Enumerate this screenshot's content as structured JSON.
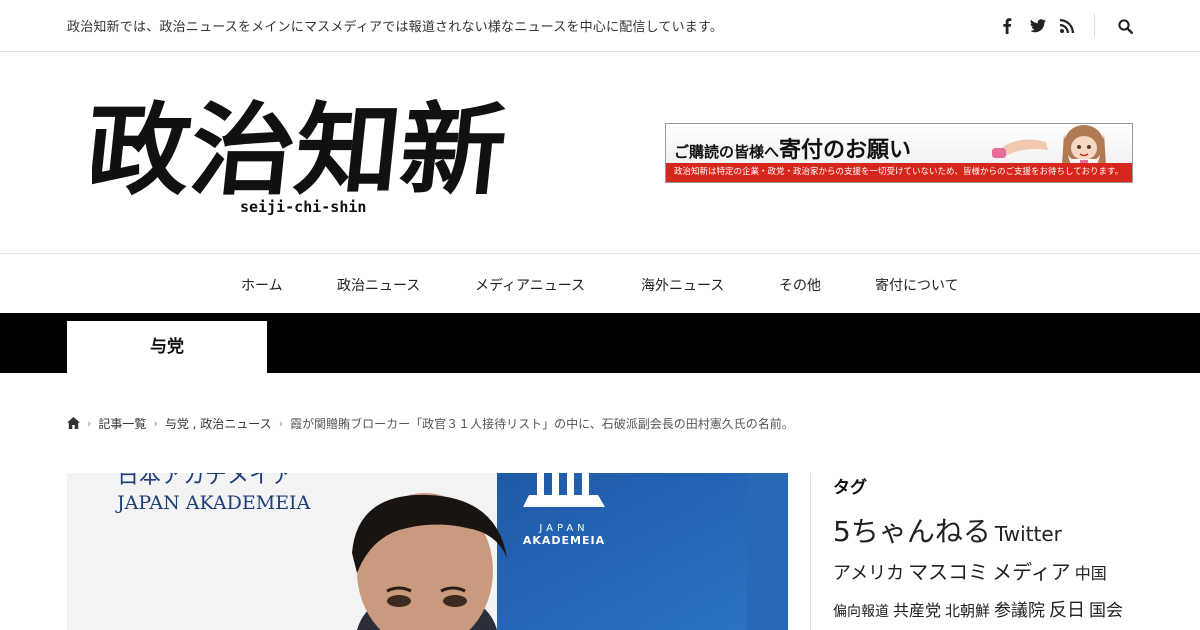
{
  "topbar": {
    "tagline": "政治知新では、政治ニュースをメインにマスメディアでは報道されない様なニュースを中心に配信しています。",
    "icons": [
      "facebook-icon",
      "twitter-icon",
      "rss-icon",
      "search-icon"
    ]
  },
  "header": {
    "logo_text": "政治知新",
    "logo_sub": "seiji-chi-shin",
    "banner": {
      "title_small1": "ご購読の皆様へ",
      "title_big": "寄付のお願い",
      "bottom_text": "政治知新は特定の企業・政党・政治家からの支援を一切受けていないため、皆様からのご支援をお待ちしております。"
    }
  },
  "nav": {
    "items": [
      "ホーム",
      "政治ニュース",
      "メディアニュース",
      "海外ニュース",
      "その他",
      "寄付について"
    ]
  },
  "category": {
    "label": "与党"
  },
  "breadcrumb": {
    "home_icon": "home-icon",
    "items": [
      "記事一覧",
      "与党 , 政治ニュース",
      "霞が関贈賄ブローカー「政官３１人接待リスト」の中に、石破派副会長の田村憲久氏の名前。"
    ]
  },
  "photo": {
    "text_top": "日本アカデメイア",
    "text_en": "JAPAN AKADEMEIA",
    "logo_line1": "JAPAN",
    "logo_line2": "AKADEMEIA"
  },
  "sidebar": {
    "title": "タグ",
    "tags": [
      {
        "label": "5ちゃんねる",
        "size": 28
      },
      {
        "label": "Twitter",
        "size": 20
      },
      {
        "label": "アメリカ",
        "size": 18
      },
      {
        "label": "マスコミ",
        "size": 20
      },
      {
        "label": "メディア",
        "size": 20
      },
      {
        "label": "中国",
        "size": 16
      },
      {
        "label": "偏向報道",
        "size": 14
      },
      {
        "label": "共産党",
        "size": 16
      },
      {
        "label": "北朝鮮",
        "size": 15
      },
      {
        "label": "参議院",
        "size": 17
      },
      {
        "label": "反日",
        "size": 18
      },
      {
        "label": "国会",
        "size": 17
      }
    ]
  }
}
